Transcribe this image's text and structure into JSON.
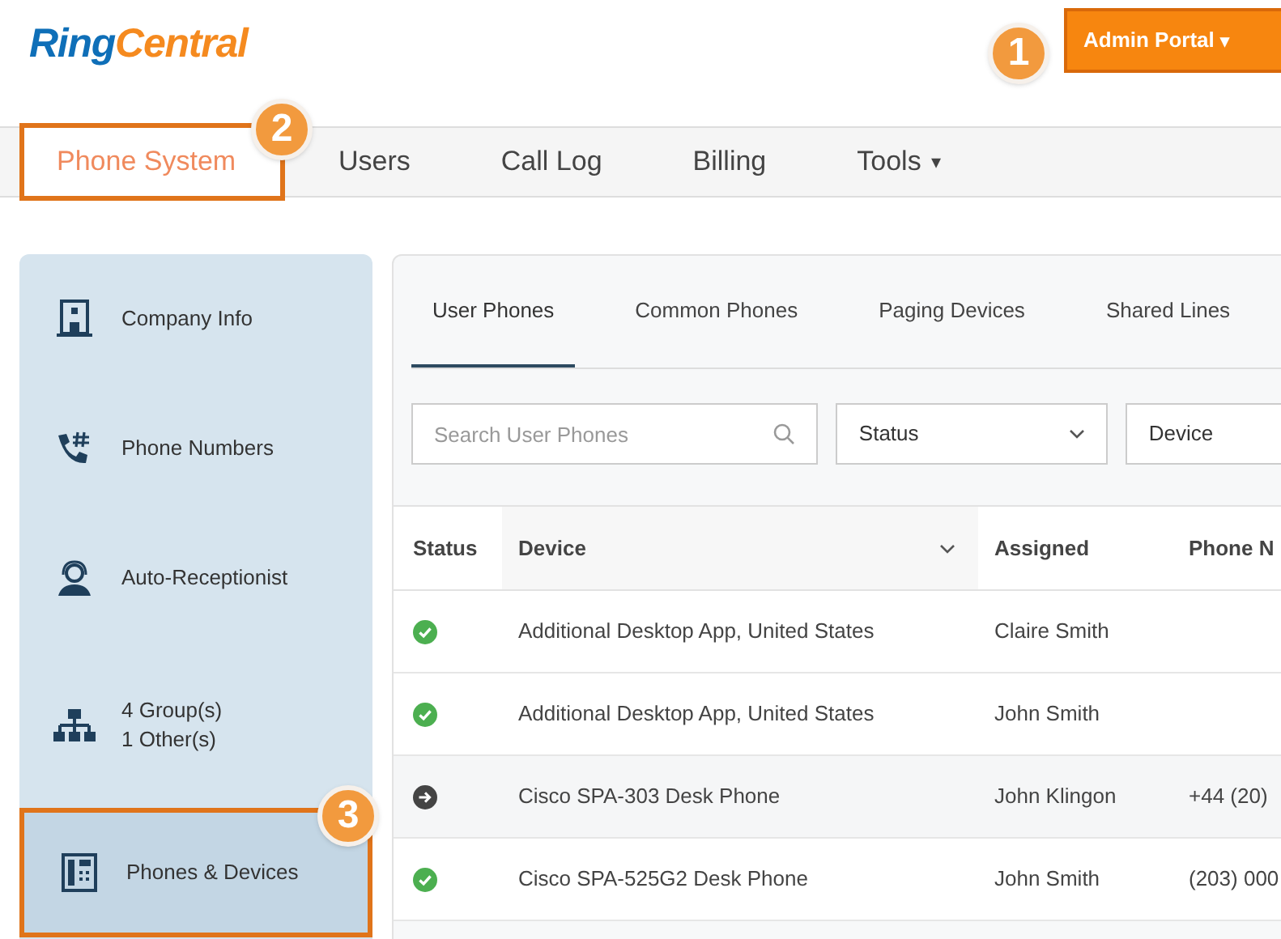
{
  "logo": {
    "first": "Ring",
    "second": "Central"
  },
  "admin_button": {
    "label": "Admin Portal",
    "caret": "▾"
  },
  "nav": [
    {
      "label": "Phone System",
      "selected": true
    },
    {
      "label": "Users",
      "selected": false
    },
    {
      "label": "Call Log",
      "selected": false
    },
    {
      "label": "Billing",
      "selected": false
    },
    {
      "label": "Tools",
      "selected": false,
      "caret": "▾"
    }
  ],
  "sidebar": {
    "items": [
      {
        "lines": [
          "Company Info"
        ],
        "selected": false
      },
      {
        "lines": [
          "Phone Numbers"
        ],
        "selected": false
      },
      {
        "lines": [
          "Auto-Receptionist"
        ],
        "selected": false
      },
      {
        "lines": [
          "4 Group(s)",
          "1 Other(s)"
        ],
        "selected": false
      },
      {
        "lines": [
          "Phones & Devices"
        ],
        "selected": true
      }
    ]
  },
  "tabs": [
    {
      "label": "User Phones",
      "selected": true
    },
    {
      "label": "Common Phones",
      "selected": false
    },
    {
      "label": "Paging Devices",
      "selected": false
    },
    {
      "label": "Shared Lines",
      "selected": false
    }
  ],
  "filters": {
    "search": {
      "placeholder": "Search User Phones"
    },
    "status": {
      "value": "Status"
    },
    "device": {
      "value": "Device"
    }
  },
  "table": {
    "columns": [
      "Status",
      "Device",
      "Assigned",
      "Phone N"
    ],
    "rows": [
      {
        "kind": "online",
        "device": "Additional Desktop App, United States",
        "assigned": "Claire Smith"
      },
      {
        "kind": "online",
        "device": "Additional Desktop App, United States",
        "assigned": "John Smith"
      },
      {
        "kind": "forwarding",
        "device": "Cisco SPA-303 Desk Phone",
        "assigned": "John Klingon",
        "phone": "+44 (20)"
      },
      {
        "kind": "online",
        "device": "Cisco SPA-525G2 Desk Phone",
        "assigned": "John Smith",
        "phone": "(203) 000"
      }
    ]
  },
  "callouts": [
    "1",
    "2",
    "3"
  ]
}
